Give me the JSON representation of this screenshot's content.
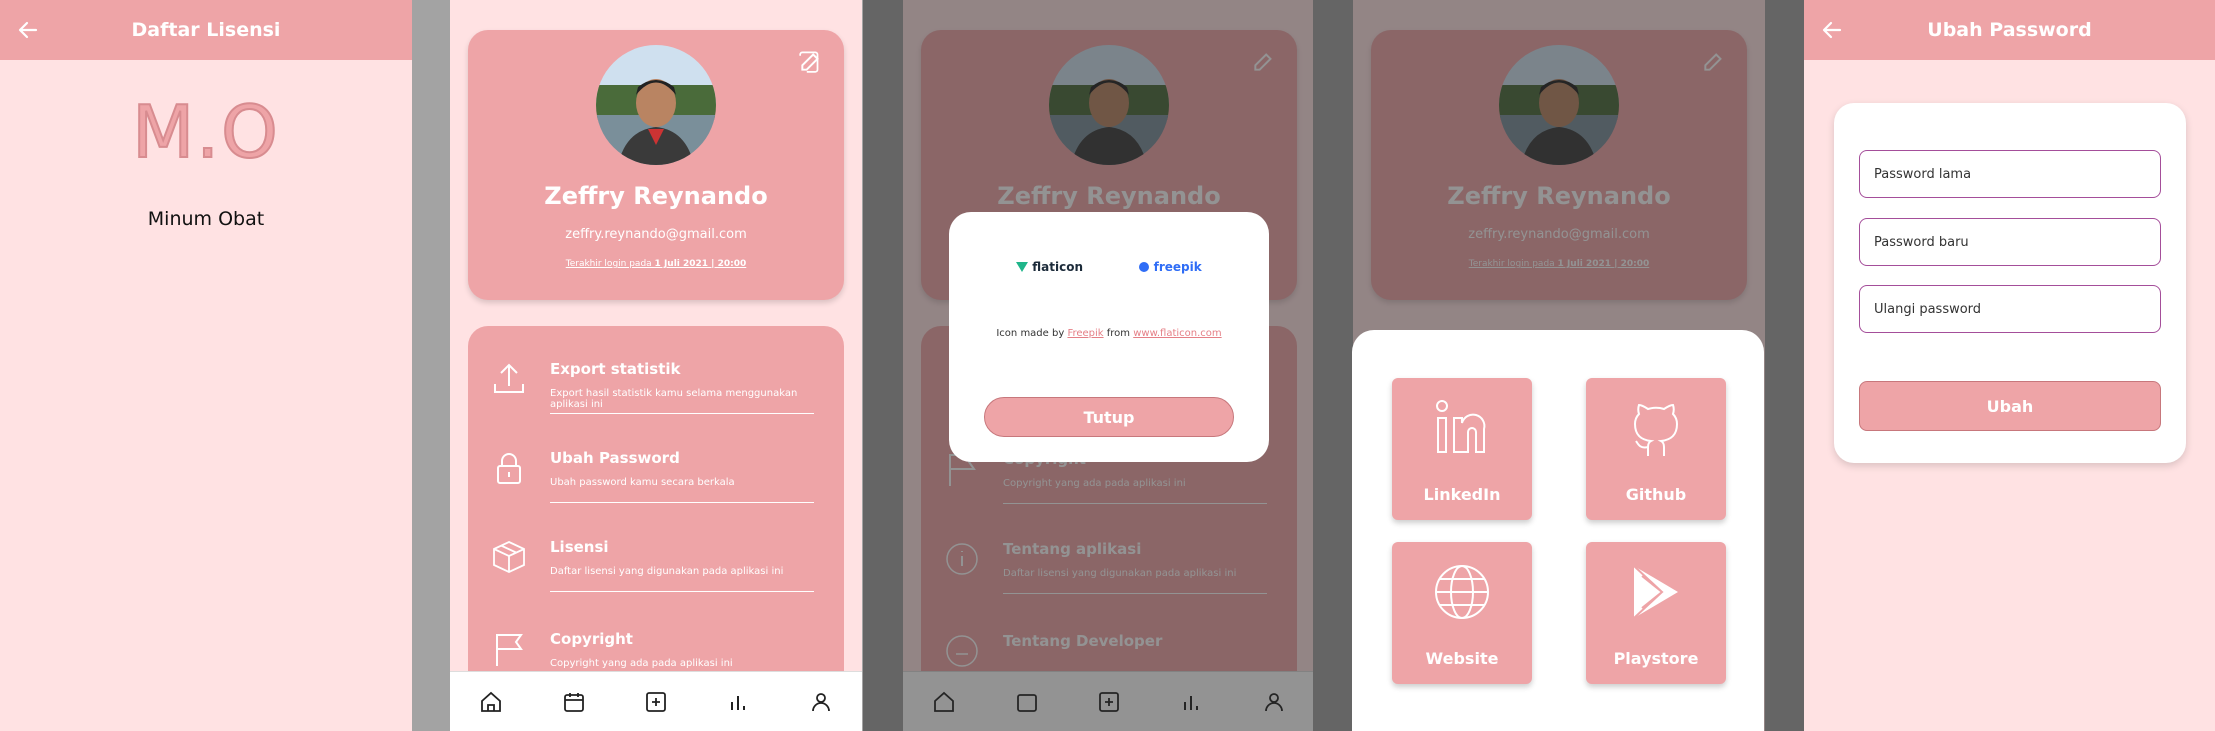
{
  "screen1": {
    "title": "Daftar Lisensi",
    "logo": "M.O",
    "app_name": "Minum Obat"
  },
  "profile": {
    "name": "Zeffry Reynando",
    "email": "zeffry.reynando@gmail.com",
    "last_login_prefix": "Terakhir login pada ",
    "last_login_value": "1 Juli 2021 | 20:00"
  },
  "menu": {
    "items": [
      {
        "title": "Export statistik",
        "desc": "Export hasil statistik kamu selama menggunakan aplikasi ini",
        "icon": "upload-icon"
      },
      {
        "title": "Ubah Password",
        "desc": "Ubah password kamu secara berkala",
        "icon": "lock-icon"
      },
      {
        "title": "Lisensi",
        "desc": "Daftar lisensi yang digunakan pada aplikasi ini",
        "icon": "box-icon"
      },
      {
        "title": "Copyright",
        "desc": "Copyright yang ada pada aplikasi ini",
        "icon": "flag-icon"
      }
    ],
    "items_bg": [
      {
        "title": "Copyright",
        "desc": "Copyright yang ada pada aplikasi ini"
      },
      {
        "title": "Tentang aplikasi",
        "desc": "Daftar lisensi yang digunakan pada aplikasi ini"
      },
      {
        "title": "Tentang Developer",
        "desc": ""
      }
    ]
  },
  "nav": [
    "home-icon",
    "calendar-icon",
    "add-icon",
    "stats-icon",
    "profile-icon"
  ],
  "dialog": {
    "flaticon": "flaticon",
    "freepik": "freepik",
    "attrib_prefix": "Icon made by ",
    "attrib_author": "Freepik",
    "attrib_mid": " from ",
    "attrib_site": "www.flaticon.com",
    "close_label": "Tutup"
  },
  "links": {
    "linkedin": "LinkedIn",
    "github": "Github",
    "website": "Website",
    "playstore": "Playstore"
  },
  "password": {
    "title": "Ubah Password",
    "old_placeholder": "Password lama",
    "new_placeholder": "Password baru",
    "repeat_placeholder": "Ulangi password",
    "submit_label": "Ubah"
  },
  "colors": {
    "primary": "#eea4a7",
    "background": "#ffe2e3",
    "field_border": "#a44e9a"
  }
}
